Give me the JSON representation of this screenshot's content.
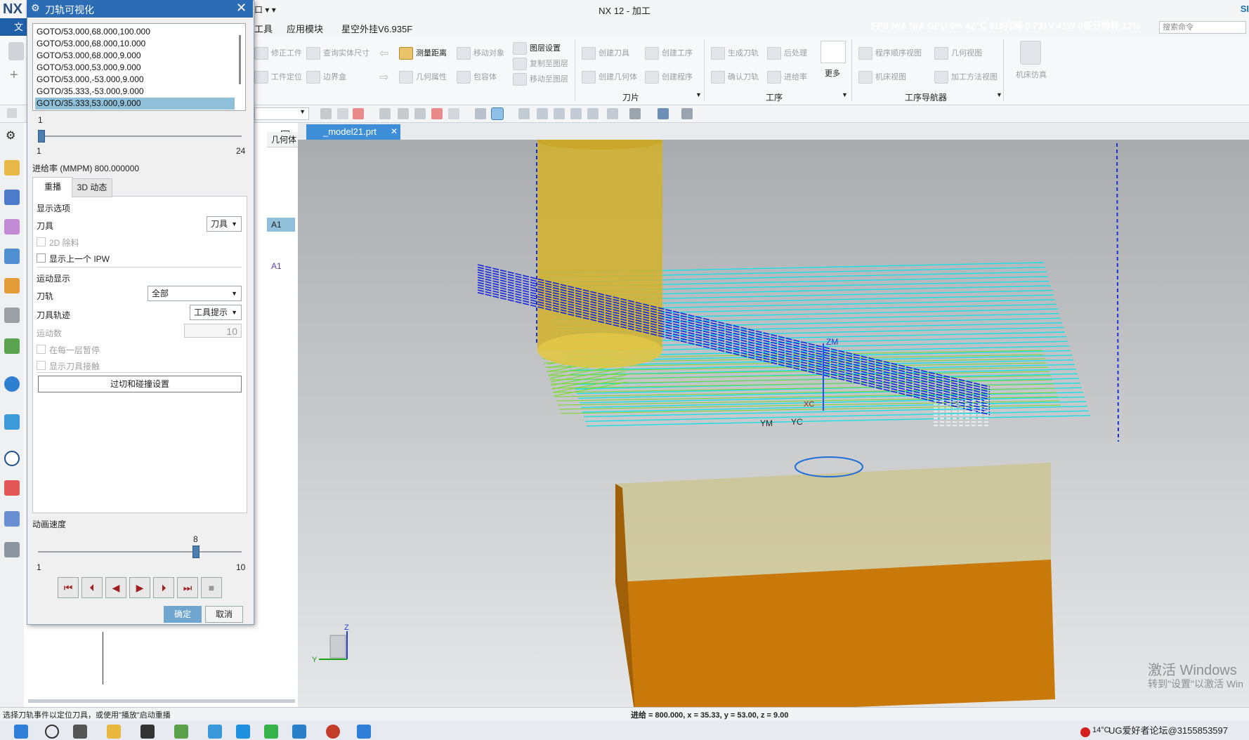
{
  "titlebar": {
    "logo": "NX",
    "title": "NX 12 - 加工",
    "menu_fragment": "口 ▾ ▾",
    "right_fragment": "SI"
  },
  "menubar": {
    "file": "文",
    "items": [
      "工具",
      "应用模块",
      "星空外挂V6.935F"
    ],
    "fps_line": "FPS N/A N/A GPU 9% 42℃ 315兆赫 0.731V 41W 0每分钟转 13%",
    "search_placeholder": "搜索命令"
  },
  "ribbon": {
    "buttons_row1": [
      "修正工件",
      "查询实体尺寸",
      "测量距离",
      "移动对象",
      "图层设置",
      "创建刀具",
      "创建工序",
      "生成刀轨",
      "后处理",
      "程序顺序视图",
      "几何视图",
      "机床仿真"
    ],
    "buttons_row2": [
      "工件定位",
      "边界盒",
      "几何属性",
      "包容体",
      "复制至图层",
      "移动至图层",
      "创建几何体",
      "创建程序",
      "确认刀轨",
      "进给率",
      "机床视图",
      "加工方法视图"
    ],
    "more": "更多",
    "groups": [
      "刀片",
      "工序",
      "工序导航器"
    ]
  },
  "navigator": {
    "col_header": "几何体",
    "cells": [
      "A1",
      "A1"
    ]
  },
  "viewport": {
    "tab_label": "_model21.prt",
    "axis_labels": [
      "ZM",
      "YM",
      "XC",
      "YC"
    ],
    "triad": [
      "Z",
      "Y"
    ],
    "watermark_line1": "激活 Windows",
    "watermark_line2": "转到\"设置\"以激活 Win"
  },
  "status": {
    "left": "选择刀轨事件以定位刀具，或使用\"播放\"启动重播",
    "coords": "进给 = 800.000, x = 35.33, y = 53.00, z = 9.00"
  },
  "taskbar": {
    "temp": "14°C",
    "tray_text": "UG爱好者论坛@3155853597"
  },
  "dialog": {
    "title": "刀轨可视化",
    "goto_rows": [
      "GOTO/53.000,68.000,100.000",
      "GOTO/53.000,68.000,10.000",
      "GOTO/53.000,68.000,9.000",
      "GOTO/53.000,53.000,9.000",
      "GOTO/53.000,-53.000,9.000",
      "GOTO/35.333,-53.000,9.000",
      "GOTO/35.333,53.000,9.000"
    ],
    "selected_row": 6,
    "list_slider": {
      "value": "1",
      "min": "1",
      "max": "24",
      "position": 0
    },
    "feed_rate": "进给率 (MMPM) 800.000000",
    "tabs": [
      "重播",
      "3D 动态"
    ],
    "display_options": "显示选项",
    "tool_label": "刀具",
    "tool_value": "刀具",
    "cb_2d": "2D 除料",
    "cb_prev_ipw": "显示上一个 IPW",
    "motion_display": "运动显示",
    "path_label": "刀轨",
    "path_value": "全部",
    "trace_label": "刀具轨迹",
    "trace_value": "工具提示",
    "motion_count_label": "运动数",
    "motion_count_value": "10",
    "cb_pause": "在每一层暂停",
    "cb_contact": "显示刀具接触",
    "collision_btn": "过切和碰撞设置",
    "anim_speed_label": "动画速度",
    "anim_speed": {
      "value": "8",
      "min": "1",
      "max": "10",
      "fraction": 0.78
    },
    "playback": [
      "⏮",
      "⏴",
      "◀",
      "▶",
      "⏵",
      "⏭",
      "■"
    ],
    "ok": "确定",
    "cancel": "取消"
  }
}
